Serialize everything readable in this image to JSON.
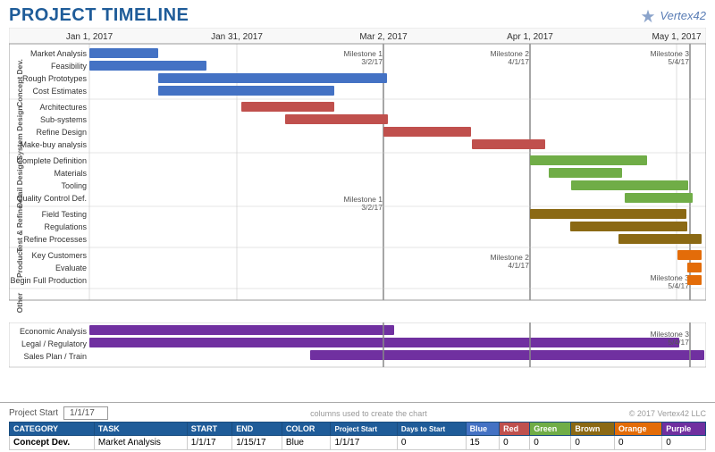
{
  "header": {
    "title": "PROJECT TIMELINE",
    "logo_text": "Vertex42",
    "logo_symbol": "❄"
  },
  "timeline": {
    "dates": [
      "Jan 1, 2017",
      "Jan 31, 2017",
      "Mar 2, 2017",
      "Apr 1, 2017",
      "May 1, 2017"
    ],
    "milestones": [
      {
        "label": "Milestone 1\n3/2/17",
        "pos": 0.38
      },
      {
        "label": "Milestone 2\n4/1/17",
        "pos": 0.62
      },
      {
        "label": "Milestone 3\n5/4/17",
        "pos": 0.87
      }
    ]
  },
  "categories": [
    {
      "name": "Concept Dev.",
      "tasks": [
        "Market Analysis",
        "Feasibility",
        "Rough Prototypes",
        "Cost Estimates"
      ]
    },
    {
      "name": "System Design",
      "tasks": [
        "Architectures",
        "Sub-systems",
        "Refine Design",
        "Make-buy analysis"
      ]
    },
    {
      "name": "Detail Design",
      "tasks": [
        "Complete Definition",
        "Materials",
        "Tooling",
        "Quality Control Def."
      ]
    },
    {
      "name": "Test & Refine",
      "tasks": [
        "Field Testing",
        "Regulations",
        "Refine Processes"
      ]
    },
    {
      "name": "Produce",
      "tasks": [
        "Key Customers",
        "Evaluate",
        "Begin Full Production"
      ]
    },
    {
      "name": "Other",
      "tasks": [
        "Economic Analysis",
        "Legal / Regulatory",
        "Sales Plan / Train"
      ]
    }
  ],
  "bottom": {
    "project_start_label": "Project Start",
    "project_start_value": "1/1/17",
    "columns_note": "columns used to create the chart",
    "copyright": "© 2017 Vertex42 LLC"
  },
  "table": {
    "headers": [
      "CATEGORY",
      "TASK",
      "START",
      "END",
      "COLOR",
      "Project Start",
      "Days to Start",
      "Blue",
      "Red",
      "Green",
      "Brown",
      "Orange",
      "Purple"
    ],
    "rows": [
      [
        "Concept Dev.",
        "Market Analysis",
        "1/1/17",
        "1/15/17",
        "Blue",
        "1/1/17",
        "0",
        "15",
        "0",
        "0",
        "0",
        "0",
        "0"
      ]
    ]
  },
  "colors": {
    "blue": "#4472C4",
    "red": "#C0504D",
    "green": "#70AD47",
    "brown": "#8B6914",
    "orange": "#E36C09",
    "purple": "#7030A0",
    "milestone": "#888888",
    "header_bg": "#1F5C99"
  }
}
